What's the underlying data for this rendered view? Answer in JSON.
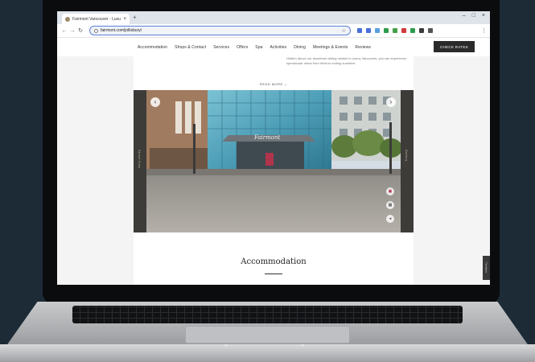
{
  "browser": {
    "tab_title": "Fairmont Vancouver - Luxur...",
    "tab_close": "×",
    "new_tab": "+",
    "window_controls": [
      "–",
      "□",
      "×"
    ],
    "nav_back": "←",
    "nav_forward": "→",
    "nav_reload": "↻",
    "url": "fairmont.com/jollisbury/",
    "omnibox_icon": "site-info-icon",
    "extension_colors": [
      "#4a6fd8",
      "#4a6fd8",
      "#5a9fe0",
      "#2e9b4f",
      "#43a047",
      "#d23b3b",
      "#2e9b4f",
      "#3a3a3a",
      "#555555"
    ]
  },
  "site": {
    "nav_links": [
      "Accommodation",
      "Shops & Contact",
      "Services",
      "Offers",
      "Spa",
      "Activities",
      "Dining",
      "Meetings & Events",
      "Reviews"
    ],
    "check_rates": "CHECK RATES",
    "intro_text": "Hidden above our downtown dining nestled in sunny Vancouver, you can experience spectacular views from West to ending sunshine.",
    "read_more": "READ MORE",
    "hero": {
      "left_label": "Street View",
      "right_label": "Gallery",
      "prev": "‹",
      "next": "›",
      "sign_text": "Fairmont",
      "tool_icons": [
        "photo-icon",
        "grid-icon",
        "share-icon"
      ]
    },
    "section_title": "Accommodation",
    "feedback_tab": "Feedback"
  }
}
